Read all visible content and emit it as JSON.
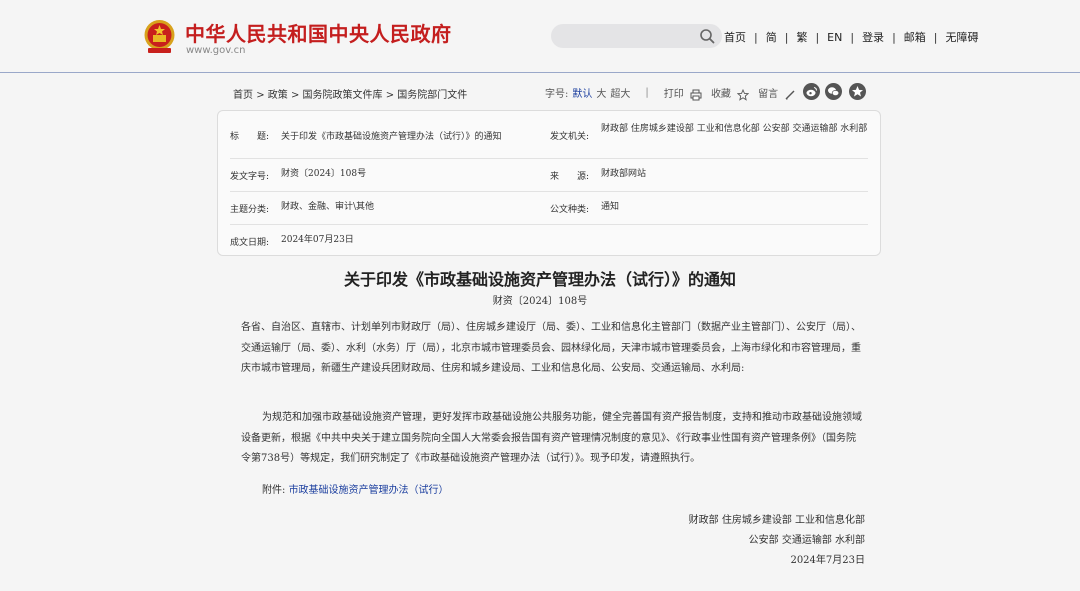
{
  "header": {
    "site_title": "中华人民共和国中央人民政府",
    "site_url": "www.gov.cn",
    "search_placeholder": "",
    "nav": [
      "首页",
      "简",
      "繁",
      "EN",
      "登录",
      "邮箱",
      "无障碍"
    ]
  },
  "breadcrumb": {
    "items": [
      "首页",
      "政策",
      "国务院政策文件库",
      "国务院部门文件"
    ],
    "separator": ">"
  },
  "tools": {
    "font_label": "字号:",
    "font_default": "默认",
    "font_large": "大",
    "font_xlarge": "超大",
    "print": "打印",
    "favorite": "收藏",
    "comment": "留言",
    "share_icons": [
      "weibo-icon",
      "wechat-icon",
      "qzone-icon"
    ]
  },
  "meta": {
    "title_label": "标　　题:",
    "title_value": "关于印发《市政基础设施资产管理办法（试行）》的通知",
    "issuer_label": "发文机关:",
    "issuer_value": "财政部  住房城乡建设部  工业和信息化部  公安部  交通运输部  水利部",
    "doc_no_label": "发文字号:",
    "doc_no_value": "财资〔2024〕108号",
    "source_label": "来　　源:",
    "source_value": "财政部网站",
    "topic_label": "主题分类:",
    "topic_value": "财政、金融、审计\\其他",
    "type_label": "公文种类:",
    "type_value": "通知",
    "date_label": "成文日期:",
    "date_value": "2024年07月23日"
  },
  "document": {
    "title": "关于印发《市政基础设施资产管理办法（试行）》的通知",
    "number": "财资〔2024〕108号",
    "recipients": "各省、自治区、直辖市、计划单列市财政厅（局）、住房城乡建设厅（局、委）、工业和信息化主管部门（数据产业主管部门）、公安厅（局）、交通运输厅（局、委）、水利（水务）厅（局），北京市城市管理委员会、园林绿化局，天津市城市管理委员会，上海市绿化和市容管理局，重庆市城市管理局，新疆生产建设兵团财政局、住房和城乡建设局、工业和信息化局、公安局、交通运输局、水利局:",
    "body": "为规范和加强市政基础设施资产管理，更好发挥市政基础设施公共服务功能，健全完善国有资产报告制度，支持和推动市政基础设施领域设备更新，根据《中共中央关于建立国务院向全国人大常委会报告国有资产管理情况制度的意见》、《行政事业性国有资产管理条例》（国务院令第738号）等规定，我们研究制定了《市政基础设施资产管理办法（试行）》。现予印发，请遵照执行。",
    "attachment_label": "附件:",
    "attachment_link": "市政基础设施资产管理办法（试行）",
    "signatories_line1": "财政部  住房城乡建设部  工业和信息化部",
    "signatories_line2": "公安部  交通运输部  水利部",
    "sign_date": "2024年7月23日"
  },
  "colors": {
    "brand_red": "#c41e1e",
    "link_blue": "#1c3f9f",
    "header_rule": "#9aa8c9"
  }
}
